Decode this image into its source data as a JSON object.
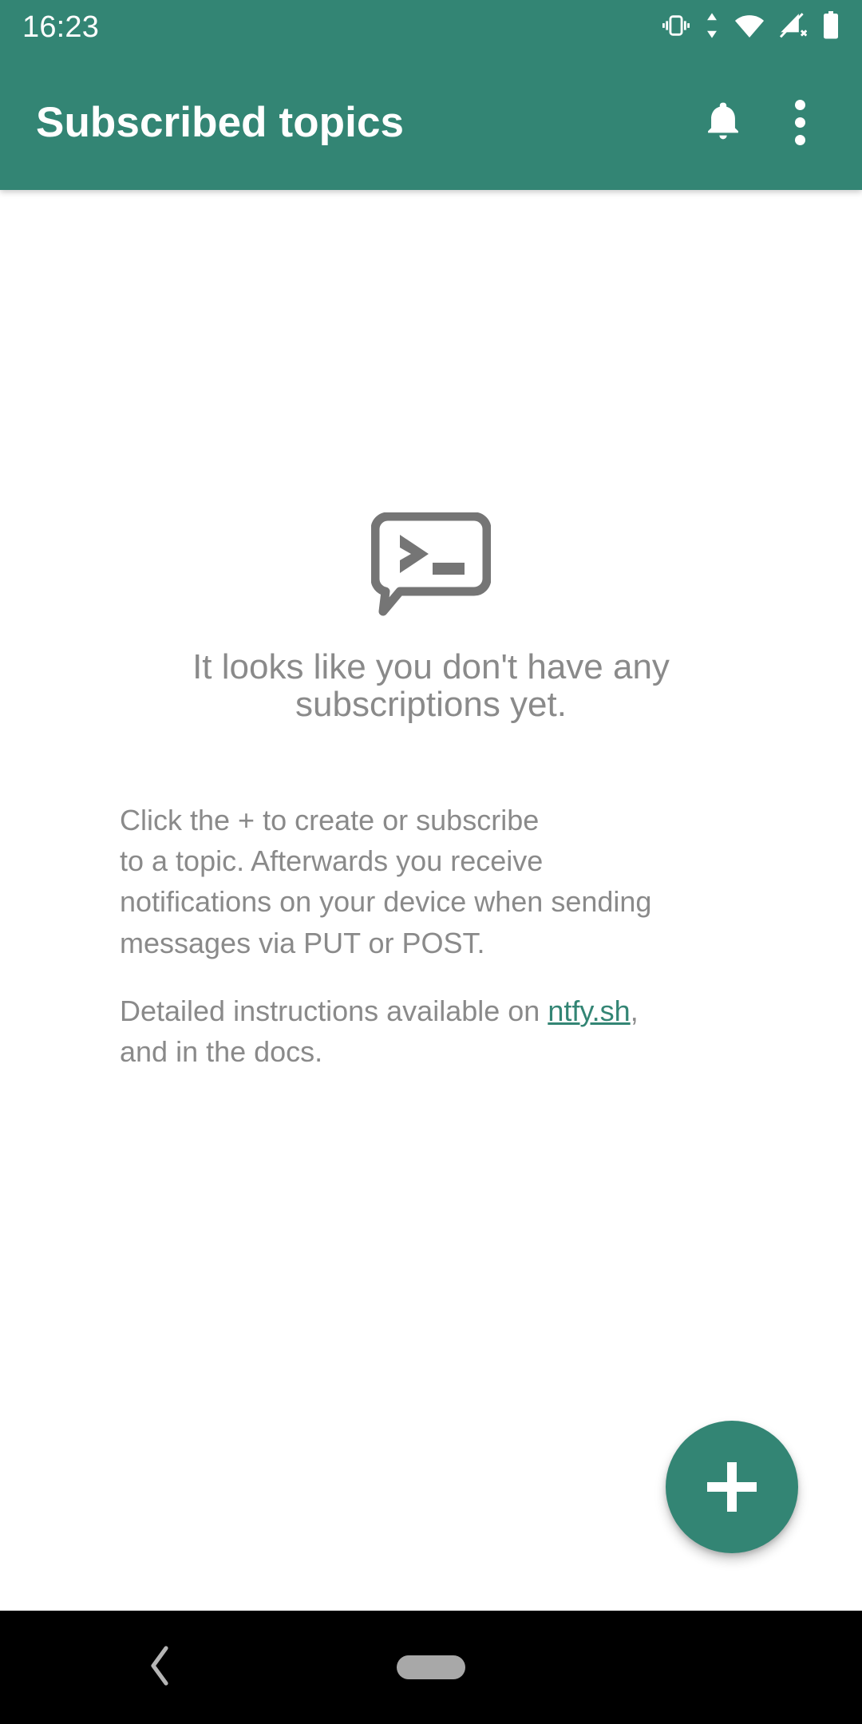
{
  "status_bar": {
    "clock": "16:23",
    "icons": [
      {
        "name": "vibrate-icon",
        "label": "vibrate"
      },
      {
        "name": "data-transfer-icon",
        "label": "data transfer"
      },
      {
        "name": "wifi-icon",
        "label": "wifi full"
      },
      {
        "name": "cellular-no-sim-icon",
        "label": "no cellular signal"
      },
      {
        "name": "battery-full-icon",
        "label": "battery full"
      }
    ]
  },
  "app_bar": {
    "title": "Subscribed topics",
    "notifications_label": "Notifications",
    "overflow_label": "More options"
  },
  "empty_state": {
    "icon_name": "ntfy-terminal-bubble-icon",
    "heading": "It looks like you don't have any subscriptions yet.",
    "paragraph_1": "Click the + to create or subscribe\nto a topic. Afterwards you receive\nnotifications on your device when sending\nmessages via PUT or POST.",
    "paragraph_2_before": "Detailed instructions available on ",
    "paragraph_2_link": "ntfy.sh",
    "paragraph_2_after": ",\nand in the docs."
  },
  "fab": {
    "label": "+",
    "action": "Add subscription"
  },
  "nav_bar": {
    "back_label": "Back",
    "home_label": "Home"
  },
  "colors": {
    "primary_green": "#338574",
    "link_green": "#338574",
    "text_gray": "#8a8a8a",
    "icon_gray": "#757575",
    "nav_background": "#000000",
    "content_background": "#ffffff"
  }
}
